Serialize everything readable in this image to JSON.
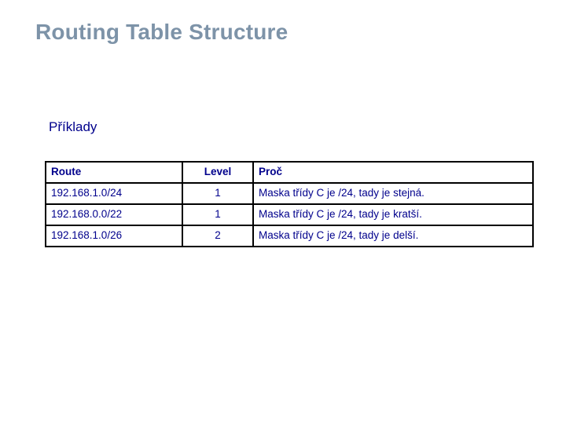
{
  "slide": {
    "title": "Routing Table Structure",
    "section_label": "Příklady",
    "title_color": "#7d93a8",
    "text_color": "#00008c",
    "border_color": "#000000",
    "background_color": "#ffffff"
  },
  "table": {
    "columns": [
      {
        "label": "Route"
      },
      {
        "label": "Level"
      },
      {
        "label": "Proč"
      }
    ],
    "rows": [
      {
        "route": "192.168.1.0/24",
        "level": "1",
        "reason": "Maska třídy C je /24, tady je stejná."
      },
      {
        "route": "192.168.0.0/22",
        "level": "1",
        "reason": "Maska třídy C je /24, tady je kratší."
      },
      {
        "route": "192.168.1.0/26",
        "level": "2",
        "reason": "Maska třídy C je /24, tady je delší."
      }
    ]
  }
}
